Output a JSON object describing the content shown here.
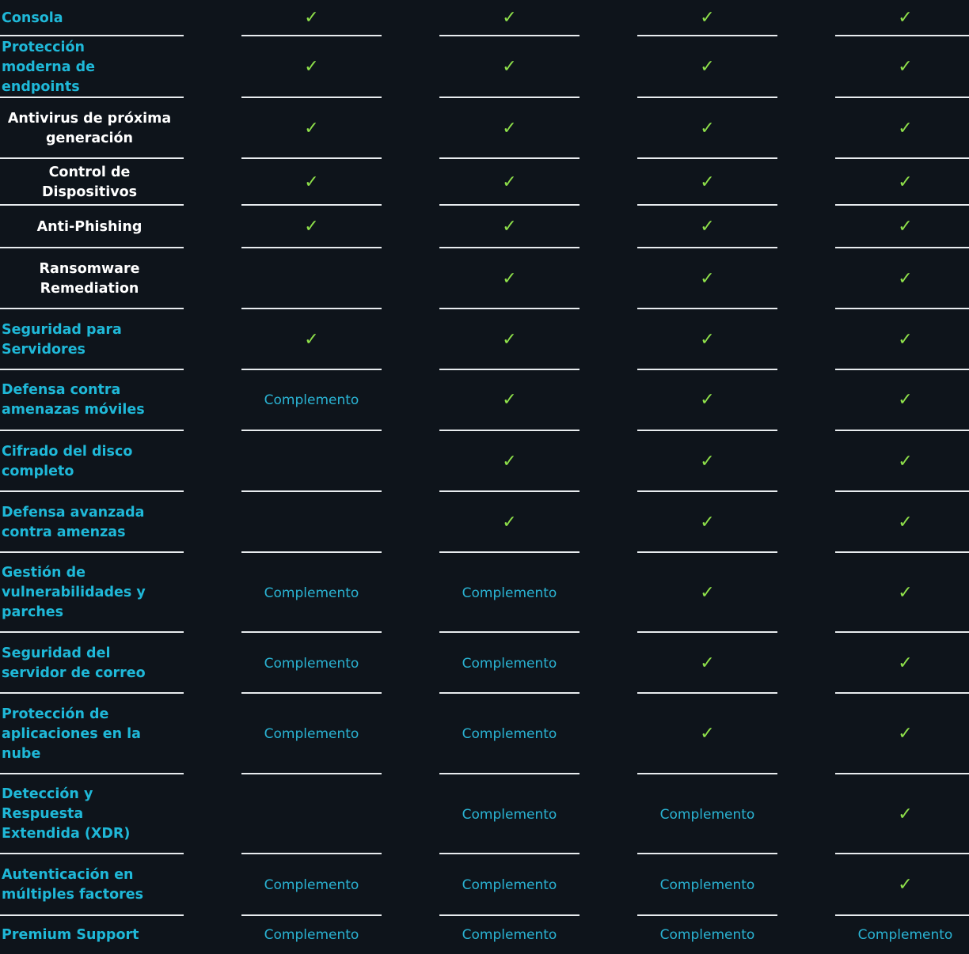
{
  "table": {
    "colors": {
      "background": "#0e141b",
      "feature_text": "#1fb8d8",
      "subfeature_text": "#ffffff",
      "check": "#8ee04a",
      "addon_text": "#2ab3d3",
      "rule": "#e8ecef"
    },
    "check_glyph": "✓",
    "addon_label": "Complemento",
    "rows": [
      {
        "feature": "Consola",
        "sub": false,
        "cells": [
          "check",
          "check",
          "check",
          "check"
        ]
      },
      {
        "feature": "Protección moderna de endpoints",
        "sub": false,
        "cells": [
          "check",
          "check",
          "check",
          "check"
        ]
      },
      {
        "feature": "Antivirus de próxima generación",
        "sub": true,
        "cells": [
          "check",
          "check",
          "check",
          "check"
        ]
      },
      {
        "feature": "Control de Dispositivos",
        "sub": true,
        "cells": [
          "check",
          "check",
          "check",
          "check"
        ]
      },
      {
        "feature": "Anti-Phishing",
        "sub": true,
        "cells": [
          "check",
          "check",
          "check",
          "check"
        ]
      },
      {
        "feature": "Ransomware Remediation",
        "sub": true,
        "cells": [
          "none",
          "check",
          "check",
          "check"
        ]
      },
      {
        "feature": "Seguridad para Servidores",
        "sub": false,
        "cells": [
          "check",
          "check",
          "check",
          "check"
        ]
      },
      {
        "feature": "Defensa contra amenazas móviles",
        "sub": false,
        "cells": [
          "addon",
          "check",
          "check",
          "check"
        ]
      },
      {
        "feature": "Cifrado del disco completo",
        "sub": false,
        "cells": [
          "none",
          "check",
          "check",
          "check"
        ]
      },
      {
        "feature": "Defensa avanzada contra amenzas",
        "sub": false,
        "cells": [
          "none",
          "check",
          "check",
          "check"
        ]
      },
      {
        "feature": "Gestión de vulnerabilidades y parches",
        "sub": false,
        "cells": [
          "addon",
          "addon",
          "check",
          "check"
        ]
      },
      {
        "feature": "Seguridad del servidor de correo",
        "sub": false,
        "cells": [
          "addon",
          "addon",
          "check",
          "check"
        ]
      },
      {
        "feature": "Protección de aplicaciones en la nube",
        "sub": false,
        "cells": [
          "addon",
          "addon",
          "check",
          "check"
        ]
      },
      {
        "feature": "Detección y Respuesta Extendida (XDR)",
        "sub": false,
        "cells": [
          "none",
          "addon",
          "addon",
          "check"
        ]
      },
      {
        "feature": "Autenticación en múltiples factores",
        "sub": false,
        "cells": [
          "addon",
          "addon",
          "addon",
          "check"
        ]
      },
      {
        "feature": "Premium Support",
        "sub": false,
        "cells": [
          "addon",
          "addon",
          "addon",
          "addon"
        ]
      }
    ]
  }
}
